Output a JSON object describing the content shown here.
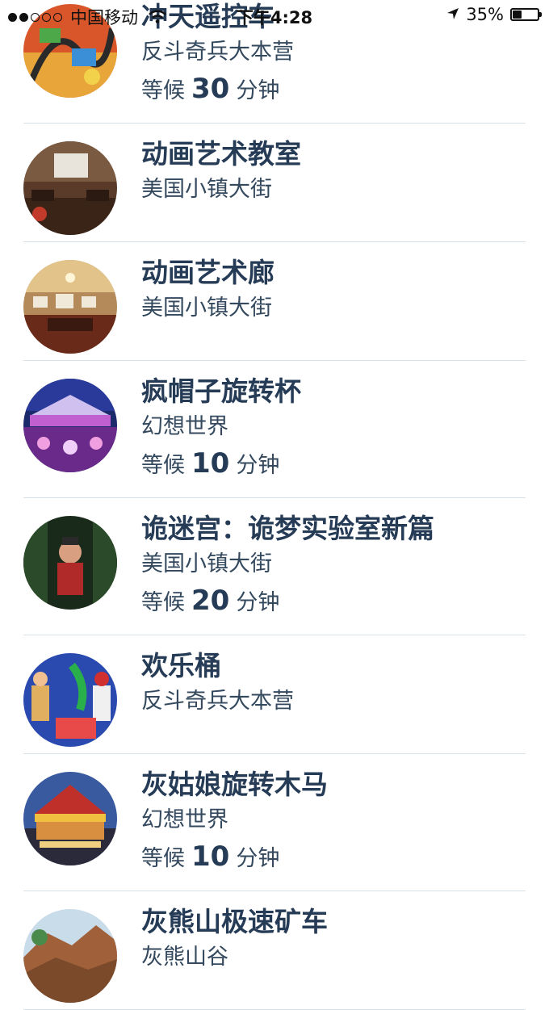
{
  "status_bar": {
    "carrier": "中国移动",
    "time": "下午4:28",
    "battery_text": "35%",
    "battery_level": 0.35
  },
  "attractions": [
    {
      "title": "冲天遥控车",
      "location": "反斗奇兵大本营",
      "wait_prefix": "等候",
      "wait_minutes": "30",
      "wait_suffix": "分钟",
      "image": "rc-racer"
    },
    {
      "title": "动画艺术教室",
      "location": "美国小镇大街",
      "image": "animation-academy"
    },
    {
      "title": "动画艺术廊",
      "location": "美国小镇大街",
      "image": "art-gallery"
    },
    {
      "title": "疯帽子旋转杯",
      "location": "幻想世界",
      "wait_prefix": "等候",
      "wait_minutes": "10",
      "wait_suffix": "分钟",
      "image": "mad-hatter"
    },
    {
      "title": "诡迷宫：诡梦实验室新篇",
      "location": "美国小镇大街",
      "wait_prefix": "等候",
      "wait_minutes": "20",
      "wait_suffix": "分钟",
      "image": "mystic-manor"
    },
    {
      "title": "欢乐桶",
      "location": "反斗奇兵大本营",
      "image": "slinky-barrel"
    },
    {
      "title": "灰姑娘旋转木马",
      "location": "幻想世界",
      "wait_prefix": "等候",
      "wait_minutes": "10",
      "wait_suffix": "分钟",
      "image": "carousel"
    },
    {
      "title": "灰熊山极速矿车",
      "location": "灰熊山谷",
      "image": "grizzly-mine"
    }
  ]
}
